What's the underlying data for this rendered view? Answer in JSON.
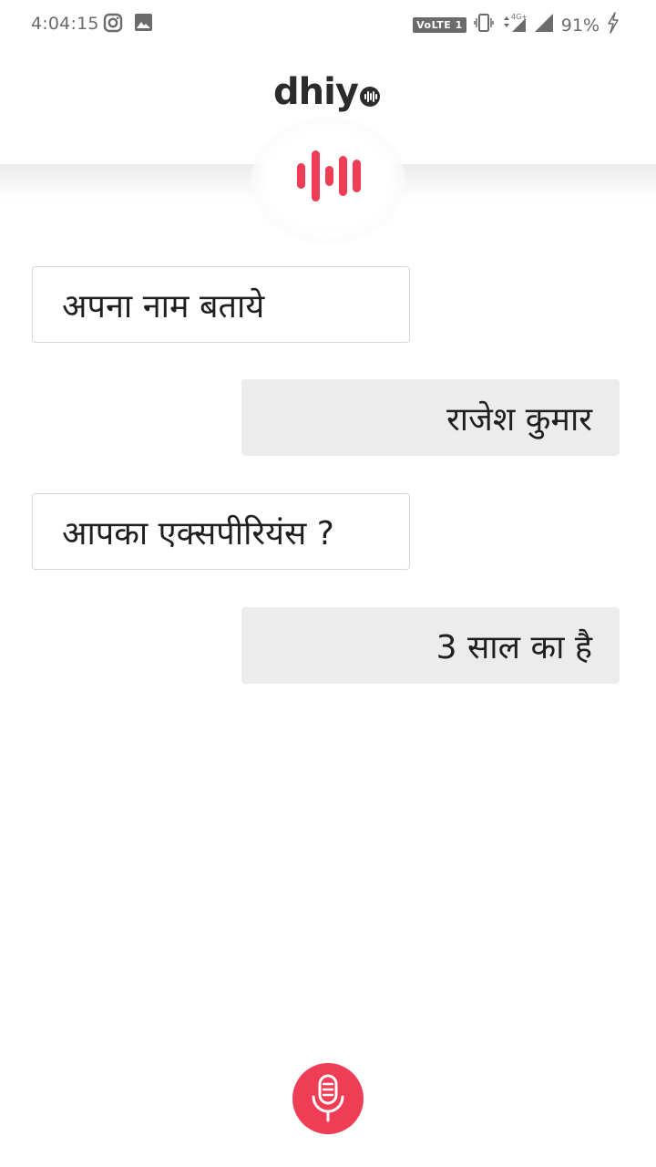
{
  "status_bar": {
    "time": "4:04:15",
    "network_tag": "VoLTE 1",
    "battery": "91%",
    "icons": [
      "instagram-icon",
      "gallery-icon",
      "vibrate-icon",
      "data-arrows-icon",
      "signal-icon",
      "battery-charging-icon"
    ]
  },
  "header": {
    "logo_text": "dhiy",
    "logo_mark": "o"
  },
  "colors": {
    "accent": "#ee3d55",
    "question_border": "#d7d7d7",
    "answer_bg": "#ececec",
    "text": "#1f1f1f"
  },
  "chat": {
    "messages": [
      {
        "role": "bot",
        "text": "अपना नाम बताये"
      },
      {
        "role": "user",
        "text": "राजेश कुमार"
      },
      {
        "role": "bot",
        "text": "आपका एक्सपीरियंस ?"
      },
      {
        "role": "user",
        "text": "3 साल का है"
      }
    ]
  },
  "mic": {
    "icon": "microphone-icon"
  }
}
